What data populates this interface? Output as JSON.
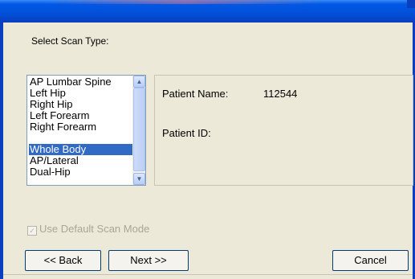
{
  "dialog": {
    "instruction": "Select Scan Type:"
  },
  "scan_types": {
    "items": [
      "AP Lumbar Spine",
      "Left Hip",
      "Right Hip",
      "Left Forearm",
      "Right Forearm",
      "Whole Body",
      "AP/Lateral",
      "Dual-Hip"
    ],
    "selected": "Whole Body"
  },
  "patient": {
    "name_label": "Patient Name:",
    "name_value": "112544",
    "id_label": "Patient ID:",
    "id_value": ""
  },
  "options": {
    "default_scan_mode_label": "Use Default Scan Mode",
    "default_scan_mode_checked": true,
    "default_scan_mode_enabled": false
  },
  "buttons": {
    "back": "<< Back",
    "next": "Next >>",
    "cancel": "Cancel"
  },
  "scrollbar": {
    "up_icon": "▲",
    "down_icon": "▼"
  },
  "colors": {
    "titlebar": "#0058e6",
    "selection": "#316ac5",
    "dialog_bg": "#ece9d8"
  }
}
